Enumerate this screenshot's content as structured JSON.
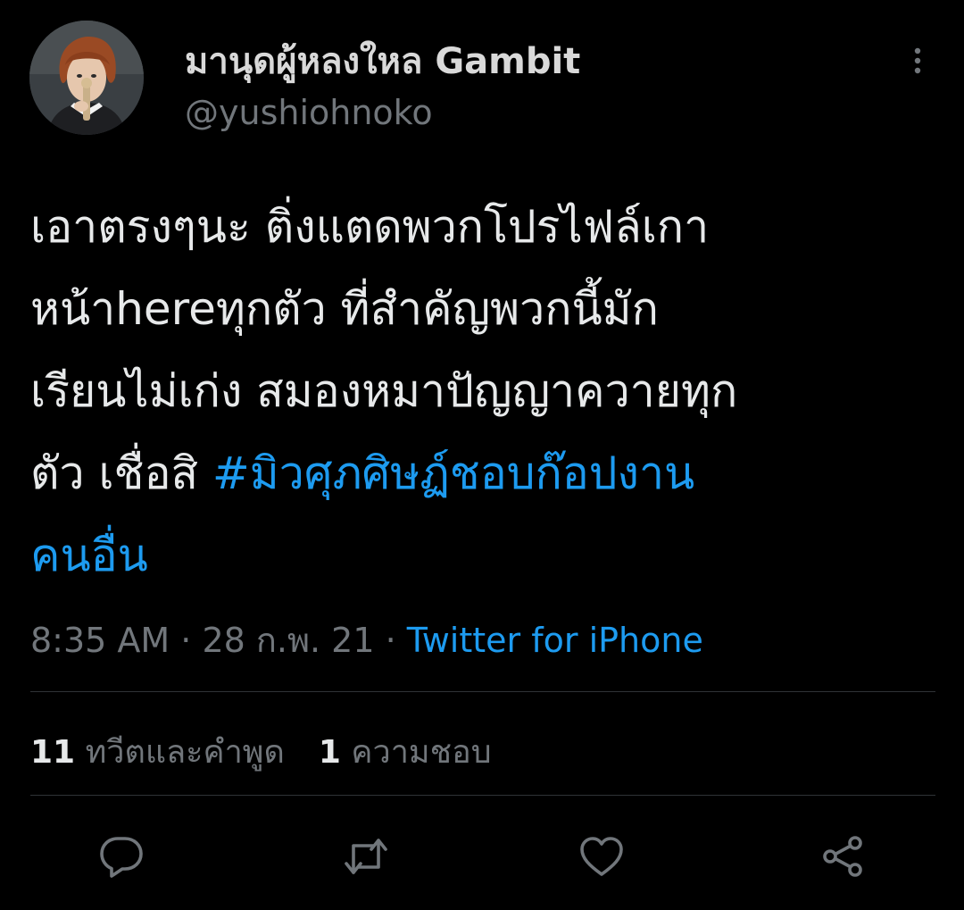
{
  "user": {
    "display_name": "มานุดผู้หลงใหล Gambit",
    "handle": "@yushiohnoko",
    "avatar_icon": "profile-photo"
  },
  "tweet": {
    "lines": [
      "เอาตรงๆนะ ติ่งแตดพวกโปรไฟล์เกา",
      "หน้าhereทุกตัว ที่สำคัญพวกนี้มัก",
      "เรียนไม่เก่ง สมองหมาปัญญาควายทุก",
      "ตัว เชื่อสิ "
    ],
    "hashtag_part1": "#มิวศุภศิษฏ์ชอบก๊อปงาน",
    "hashtag_part2": "คนอื่น"
  },
  "meta": {
    "time": "8:35 AM",
    "separator": " · ",
    "date": "28 ก.พ. 21",
    "source": "Twitter for iPhone"
  },
  "stats": {
    "retweets_count": "11",
    "retweets_label": "ทวีตและคำพูด",
    "likes_count": "1",
    "likes_label": "ความชอบ"
  },
  "actions": [
    "reply-icon",
    "retweet-icon",
    "like-icon",
    "share-icon"
  ],
  "colors": {
    "background": "#000000",
    "text": "#e7e9ea",
    "secondary": "#71767b",
    "link": "#1d9bf0",
    "divider": "#2f3336"
  }
}
